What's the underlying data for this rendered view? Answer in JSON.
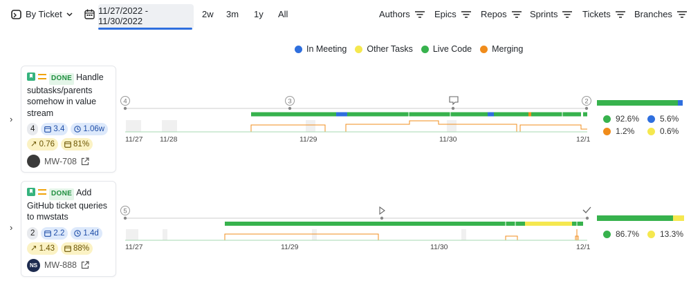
{
  "toolbar": {
    "group_by_label": "By Ticket",
    "date_range": "11/27/2022 - 11/30/2022",
    "ranges": [
      "2w",
      "3m",
      "1y",
      "All"
    ],
    "filters": [
      "Authors",
      "Epics",
      "Repos",
      "Sprints",
      "Tickets",
      "Branches"
    ]
  },
  "legend": [
    {
      "label": "In Meeting",
      "color": "#2f6fde"
    },
    {
      "label": "Other Tasks",
      "color": "#f5e84f"
    },
    {
      "label": "Live Code",
      "color": "#37b24d"
    },
    {
      "label": "Merging",
      "color": "#f08c1b"
    }
  ],
  "tickets": [
    {
      "status": "DONE",
      "title": "Handle subtasks/parents somehow in value stream",
      "count": "4",
      "days": "3.4",
      "duration": "1.06w",
      "trend": "0.76",
      "percent": "81%",
      "avatar_initials": "",
      "avatar_color": "#3a3a3a",
      "key": "MW-708",
      "timeline_markers": [
        "4",
        "3",
        "2"
      ],
      "dates": [
        "11/27",
        "11/28",
        "11/29",
        "11/30",
        "12/1"
      ],
      "breakdown": [
        {
          "value": "92.6%",
          "color": "#37b24d"
        },
        {
          "value": "5.6%",
          "color": "#2f6fde"
        },
        {
          "value": "1.2%",
          "color": "#f08c1b"
        },
        {
          "value": "0.6%",
          "color": "#f5e84f"
        }
      ]
    },
    {
      "status": "DONE",
      "title": "Add GitHub ticket queries to mwstats",
      "count": "2",
      "days": "2.2",
      "duration": "1.4d",
      "trend": "1.43",
      "percent": "88%",
      "avatar_initials": "NS",
      "avatar_color": "#1d2b4f",
      "key": "MW-888",
      "timeline_markers": [
        "5"
      ],
      "dates": [
        "11/27",
        "11/29",
        "11/30",
        "12/1"
      ],
      "breakdown": [
        {
          "value": "86.7%",
          "color": "#37b24d"
        },
        {
          "value": "13.3%",
          "color": "#f5e84f"
        }
      ]
    }
  ]
}
